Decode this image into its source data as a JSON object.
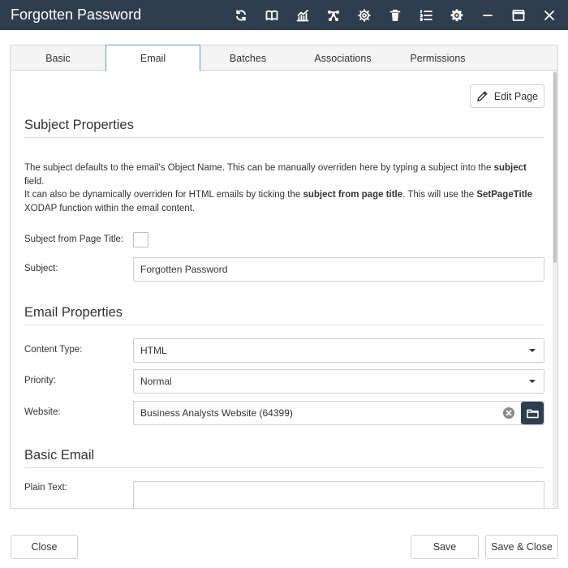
{
  "window": {
    "title": "Forgotten Password"
  },
  "toolbar": {
    "icons": [
      "refresh-icon",
      "book-icon",
      "chart-icon",
      "network-icon",
      "cog-icon",
      "trash-icon",
      "list-icon",
      "gear-icon",
      "minimize-icon",
      "maximize-icon",
      "close-icon"
    ]
  },
  "tabs": [
    {
      "label": "Basic",
      "active": false
    },
    {
      "label": "Email",
      "active": true
    },
    {
      "label": "Batches",
      "active": false
    },
    {
      "label": "Associations",
      "active": false
    },
    {
      "label": "Permissions",
      "active": false
    }
  ],
  "edit_page": {
    "label": "Edit Page"
  },
  "subject_section": {
    "title": "Subject Properties",
    "desc_1a": "The subject defaults to the email's Object Name. This can be manually overriden here by typing a subject into the ",
    "desc_1b": "subject",
    "desc_1c": " field.",
    "desc_2a": "It can also be dynamically overriden for HTML emails by ticking the ",
    "desc_2b": "subject from page title",
    "desc_2c": ". This will use the ",
    "desc_2d": "SetPageTitle",
    "desc_2e": " XODAP function within the email content.",
    "subject_from_title_label": "Subject from Page Title:",
    "subject_from_title_checked": false,
    "subject_label": "Subject:",
    "subject_value": "Forgotten Password"
  },
  "email_section": {
    "title": "Email Properties",
    "content_type_label": "Content Type:",
    "content_type_value": "HTML",
    "priority_label": "Priority:",
    "priority_value": "Normal",
    "website_label": "Website:",
    "website_value": "Business Analysts Website (64399)"
  },
  "basic_section": {
    "title": "Basic Email",
    "plain_text_label": "Plain Text:",
    "plain_text_value": ""
  },
  "footer": {
    "close_label": "Close",
    "save_label": "Save",
    "save_close_label": "Save & Close"
  }
}
